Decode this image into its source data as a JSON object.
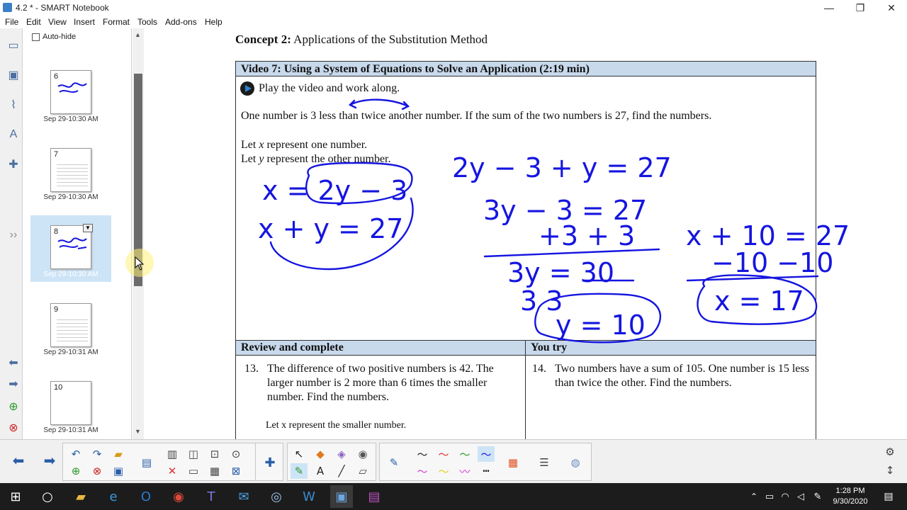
{
  "window": {
    "title": "4.2 * - SMART Notebook"
  },
  "menu": [
    "File",
    "Edit",
    "View",
    "Insert",
    "Format",
    "Tools",
    "Add-ons",
    "Help"
  ],
  "sorter": {
    "autohide_label": "Auto-hide",
    "pages": [
      {
        "num": "6",
        "date": "Sep 29-10:30 AM"
      },
      {
        "num": "7",
        "date": "Sep 29-10:30 AM"
      },
      {
        "num": "8",
        "date": "Sep 29-10:30 AM"
      },
      {
        "num": "9",
        "date": "Sep 29-10:31 AM"
      },
      {
        "num": "10",
        "date": "Sep 29-10:31 AM"
      }
    ],
    "selected_page": "8"
  },
  "page": {
    "concept_bold": "Concept 2:",
    "concept_rest": " Applications of the Substitution Method",
    "video_title": "Video 7: Using a System of Equations to Solve an Application (2:19 min)",
    "play_text": "Play the video and work along.",
    "problem": "One number is 3 less than twice another number. If the sum of the two numbers is 27, find the numbers.",
    "let_x_a": "Let ",
    "let_x_var": "x",
    "let_x_b": " represent one number.",
    "let_y_a": "Let ",
    "let_y_var": "y",
    "let_y_b": " represent the other number.",
    "review_head": "Review and complete",
    "youtry_head": "You try",
    "p13_num": "13.",
    "p13_text": "The difference of two positive numbers is 42. The larger number is 2 more than 6 times the smaller number.  Find the numbers.",
    "p13_let": "Let x represent the smaller number.",
    "p14_num": "14.",
    "p14_text": "Two numbers have a sum of 105. One number is 15 less than twice the other.  Find the numbers."
  },
  "ink": {
    "color": "#1515e0",
    "eq1": "x = 2y − 3",
    "eq2": "x + y = 27",
    "s1": "2y − 3 + y = 27",
    "s2": "3y − 3 = 27",
    "s3": "+3   + 3",
    "s4": "3y = 30",
    "s5": "3      3",
    "s6": "y = 10",
    "t1": "x + 10 = 27",
    "t2": "−10  −10",
    "t3": "x = 17"
  },
  "taskbar": {
    "time": "1:28 PM",
    "date": "9/30/2020"
  }
}
